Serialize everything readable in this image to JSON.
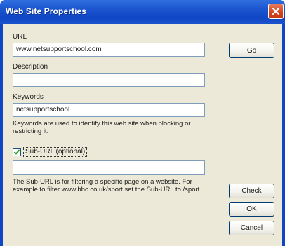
{
  "window": {
    "title": "Web Site Properties"
  },
  "form": {
    "url_label": "URL",
    "url_value": "www.netsupportschool.com",
    "description_label": "Description",
    "description_value": "",
    "keywords_label": "Keywords",
    "keywords_value": "netsupportschool",
    "keywords_hint": "Keywords are used to identify this web site when blocking or restricting it.",
    "suburl_checkbox_label": "Sub-URL (optional)",
    "suburl_checked": true,
    "suburl_value": "",
    "suburl_hint": "The Sub-URL is for filtering a specific page on a website. For example to filter www.bbc.co.uk/sport set the Sub-URL to /sport"
  },
  "buttons": {
    "go_label": "Go",
    "check_label": "Check",
    "ok_label": "OK",
    "cancel_label": "Cancel"
  },
  "icons": {
    "close": "close-icon",
    "checkmark": "checkmark-icon"
  }
}
